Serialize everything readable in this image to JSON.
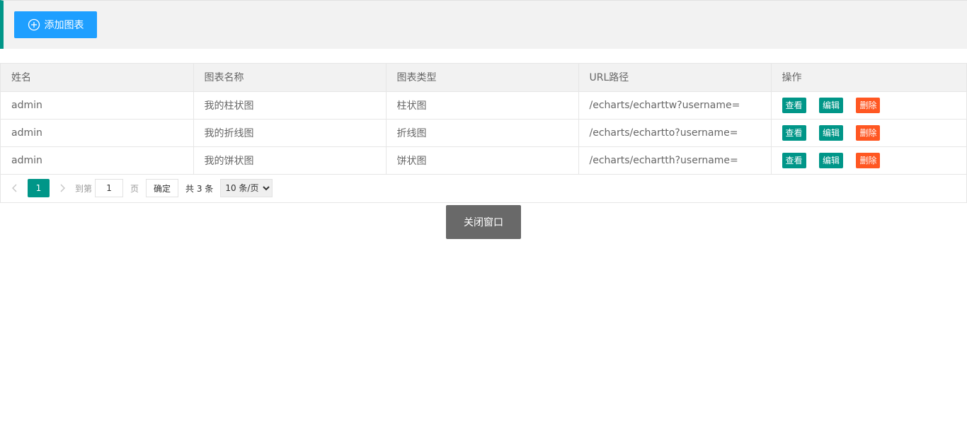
{
  "toolbar": {
    "add_label": "添加图表",
    "accent_color": "#009688",
    "button_color": "#1e9fff",
    "icon": "plus-circle-icon"
  },
  "table": {
    "headers": [
      "姓名",
      "图表名称",
      "图表类型",
      "URL路径",
      "操作"
    ],
    "rows": [
      {
        "name": "admin",
        "chart_name": "我的柱状图",
        "chart_type": "柱状图",
        "url": "/echarts/echarttw?username="
      },
      {
        "name": "admin",
        "chart_name": "我的折线图",
        "chart_type": "折线图",
        "url": "/echarts/echartto?username="
      },
      {
        "name": "admin",
        "chart_name": "我的饼状图",
        "chart_type": "饼状图",
        "url": "/echarts/echartth?username="
      }
    ],
    "actions": {
      "view": "查看",
      "edit": "编辑",
      "delete": "删除"
    },
    "delete_color": "#ff5722"
  },
  "pager": {
    "current_page": "1",
    "goto_prefix": "到第",
    "goto_value": "1",
    "goto_suffix": "页",
    "confirm": "确定",
    "total": "共 3 条",
    "page_size": "10 条/页"
  },
  "close_label": "关闭窗口"
}
